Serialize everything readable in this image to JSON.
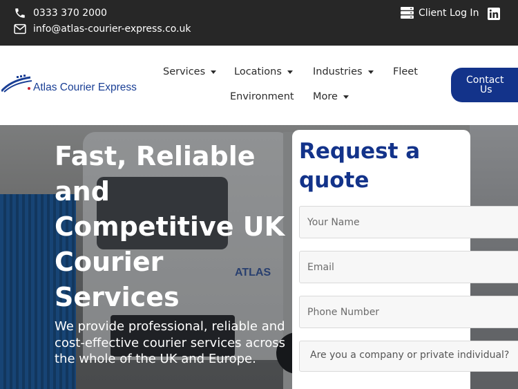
{
  "topbar": {
    "phone": "0333 370 2000",
    "email": "info@atlas-courier-express.co.uk",
    "client_login": "Client Log In",
    "phone_icon": "phone-icon",
    "email_icon": "envelope-icon",
    "login_icon": "server-icon",
    "social_icon": "linkedin-icon"
  },
  "header": {
    "logo_text": "Atlas Courier Express",
    "nav": [
      {
        "label": "Services",
        "has_dropdown": true
      },
      {
        "label": "Locations",
        "has_dropdown": true
      },
      {
        "label": "Industries",
        "has_dropdown": true
      },
      {
        "label": "Fleet",
        "has_dropdown": false
      },
      {
        "label": "Environment",
        "has_dropdown": false
      },
      {
        "label": "More",
        "has_dropdown": true
      }
    ],
    "contact_label_line1": "Contact",
    "contact_label_line2": "Us"
  },
  "hero": {
    "title": "Fast, Reliable and Competitive UK Courier Services",
    "subtitle": "We provide professional, reliable and cost-effective courier services across the whole of the UK and Europe.",
    "truck_text": "ATLAS"
  },
  "quote": {
    "title": "Request a quote",
    "name_placeholder": "Your Name",
    "email_placeholder": "Email",
    "phone_placeholder": "Phone Number",
    "type_select": "Are you a company or private individual?"
  },
  "colors": {
    "brand_blue": "#13338a",
    "topbar_bg": "#272727"
  }
}
